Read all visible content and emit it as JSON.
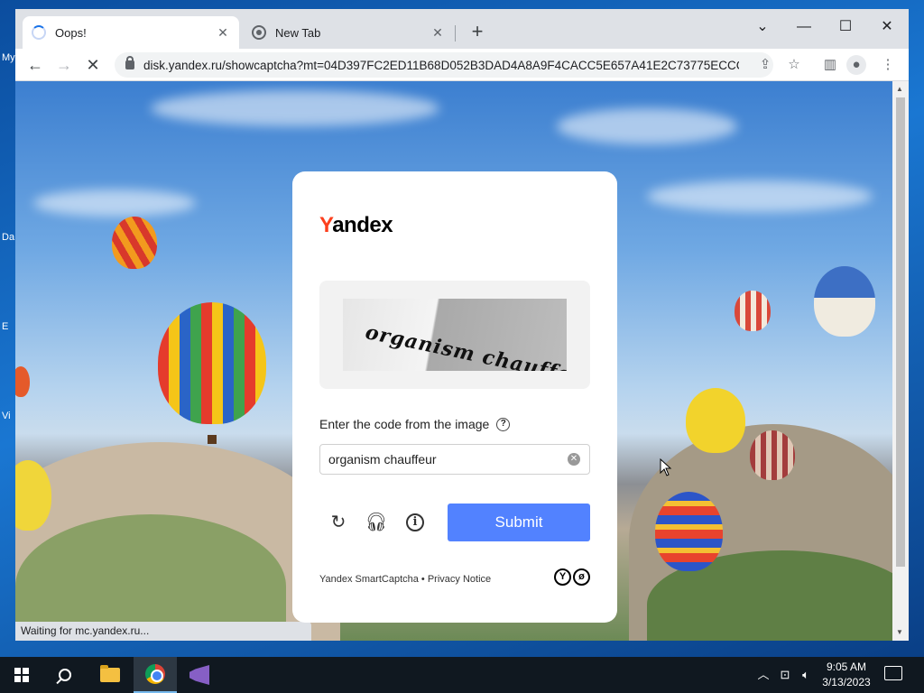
{
  "desktop": {
    "labels": [
      "My",
      "Da",
      "E",
      "Vi"
    ]
  },
  "browser": {
    "tabs": [
      {
        "title": "Oops!",
        "state": "loading"
      },
      {
        "title": "New Tab",
        "state": "idle"
      }
    ],
    "url": "disk.yandex.ru/showcaptcha?mt=04D397FC2ED11B68D052B3DAD4A8A9F4CACC5E657A41E2C73775ECCC...",
    "status_text": "Waiting for mc.yandex.ru..."
  },
  "captcha": {
    "logo_first": "Y",
    "logo_rest": "andex",
    "image_text": "organism chauffeur",
    "prompt": "Enter the code from the image",
    "input_value": "organism chauffeur",
    "submit_label": "Submit",
    "footer_service": "Yandex SmartCaptcha",
    "footer_separator": " • ",
    "footer_privacy": "Privacy Notice",
    "brand_letters": [
      "Y",
      "ø"
    ]
  },
  "taskbar": {
    "time": "9:05 AM",
    "date": "3/13/2023"
  },
  "colors": {
    "submit": "#5282ff",
    "logo_accent": "#fc3f1d"
  }
}
